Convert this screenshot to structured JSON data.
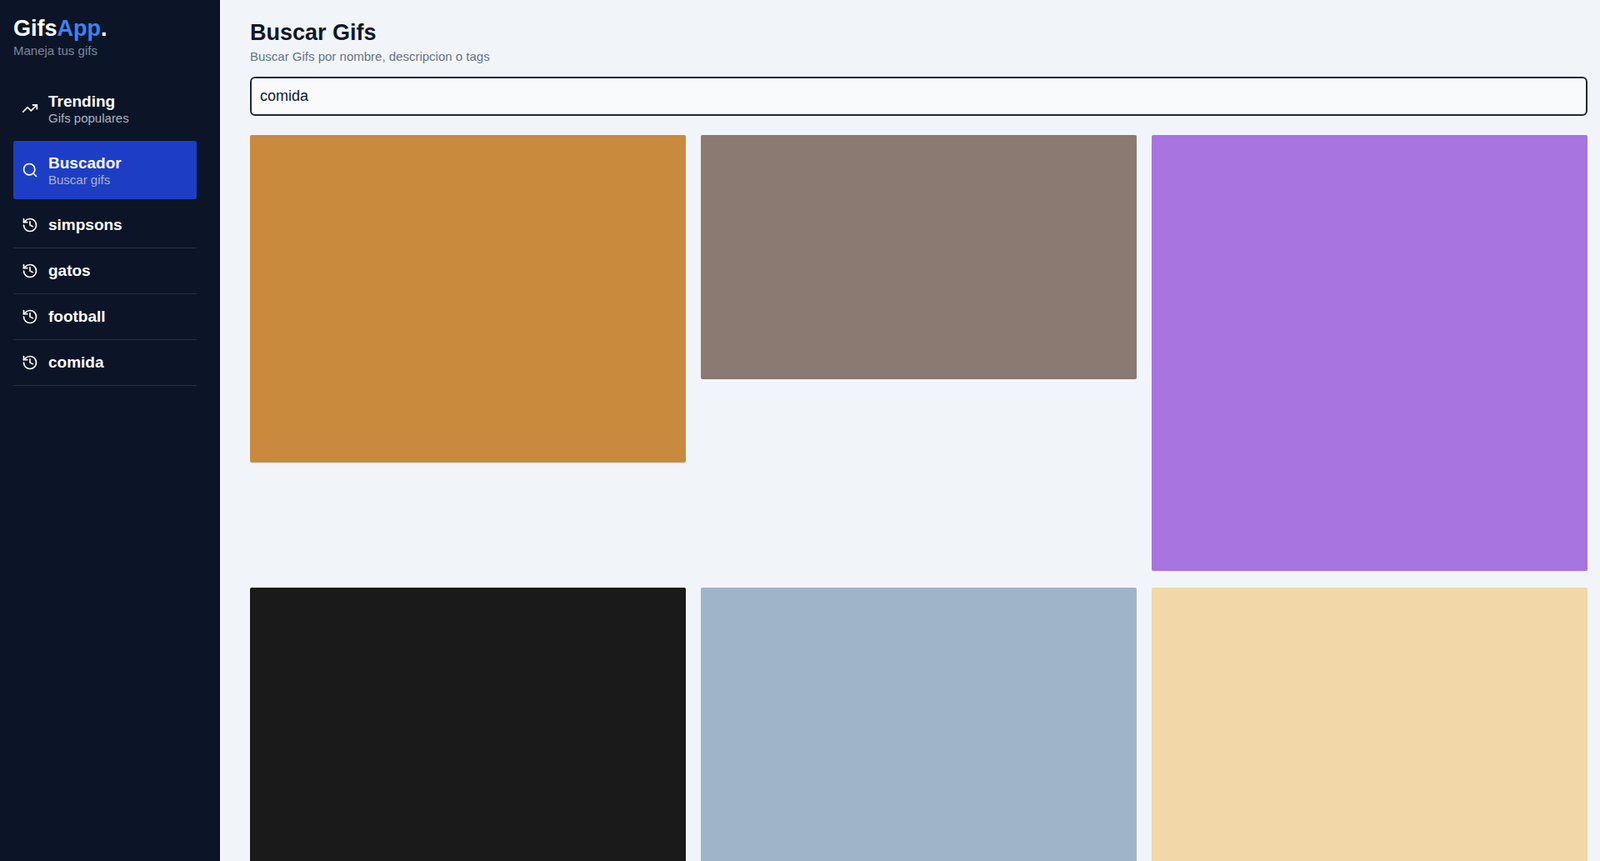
{
  "app": {
    "logo_main": "Gifs",
    "logo_accent": "App",
    "logo_dot": ".",
    "tagline": "Maneja tus gifs"
  },
  "menu": [
    {
      "kind": "trending",
      "label": "Trending",
      "subtitle": "Gifs populares",
      "selected": false
    },
    {
      "kind": "search",
      "label": "Buscador",
      "subtitle": "Buscar gifs",
      "selected": true
    }
  ],
  "history": [
    {
      "label": "simpsons",
      "selected": false
    },
    {
      "label": "gatos",
      "selected": false
    },
    {
      "label": "football",
      "selected": false
    },
    {
      "label": "comida",
      "selected": false
    }
  ],
  "page": {
    "title": "Buscar Gifs",
    "subtitle": "Buscar Gifs por nombre, descripcion o tags"
  },
  "search": {
    "value": "comida"
  },
  "gifs": [
    {
      "color": "#c98a3e"
    },
    {
      "color": "#8a7a72"
    },
    {
      "color": "#a774e0"
    },
    {
      "color": "#1a1a1a"
    },
    {
      "color": "#9fb4c8"
    },
    {
      "color": "#f2d7a8"
    }
  ]
}
